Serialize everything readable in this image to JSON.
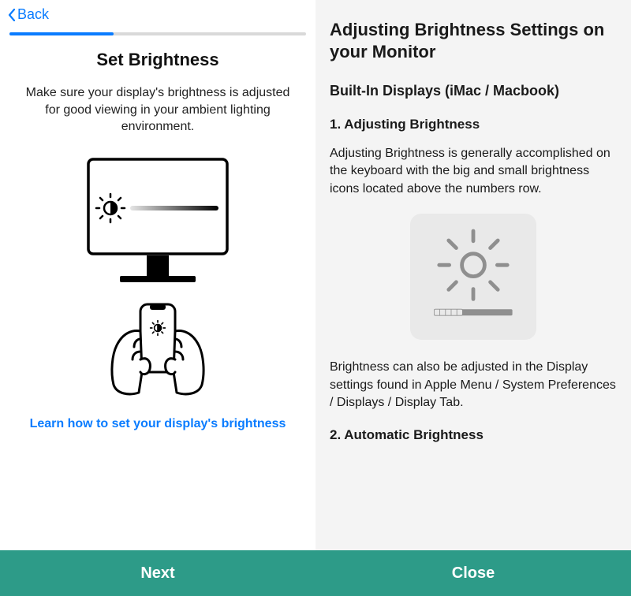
{
  "left": {
    "back_label": "Back",
    "progress_percent": 35,
    "title": "Set Brightness",
    "description": "Make sure your display's brightness is adjusted for good viewing in your ambient lighting environment.",
    "learn_link": "Learn how to set your display's brightness",
    "next_label": "Next"
  },
  "right": {
    "title": "Adjusting Brightness Settings on your Monitor",
    "subtitle": "Built-In Displays (iMac / Macbook)",
    "section1_heading": "1. Adjusting Brightness",
    "section1_para1": "Adjusting Brightness is generally accomplished on the keyboard with the big and small brightness icons located above the numbers row.",
    "section1_para2": "Brightness can also be adjusted in the Display settings found in Apple Menu / System Preferences / Displays / Display Tab.",
    "section2_heading": "2. Automatic Brightness",
    "close_label": "Close"
  },
  "colors": {
    "accent": "#0a7cff",
    "footer": "#2d9b88"
  }
}
